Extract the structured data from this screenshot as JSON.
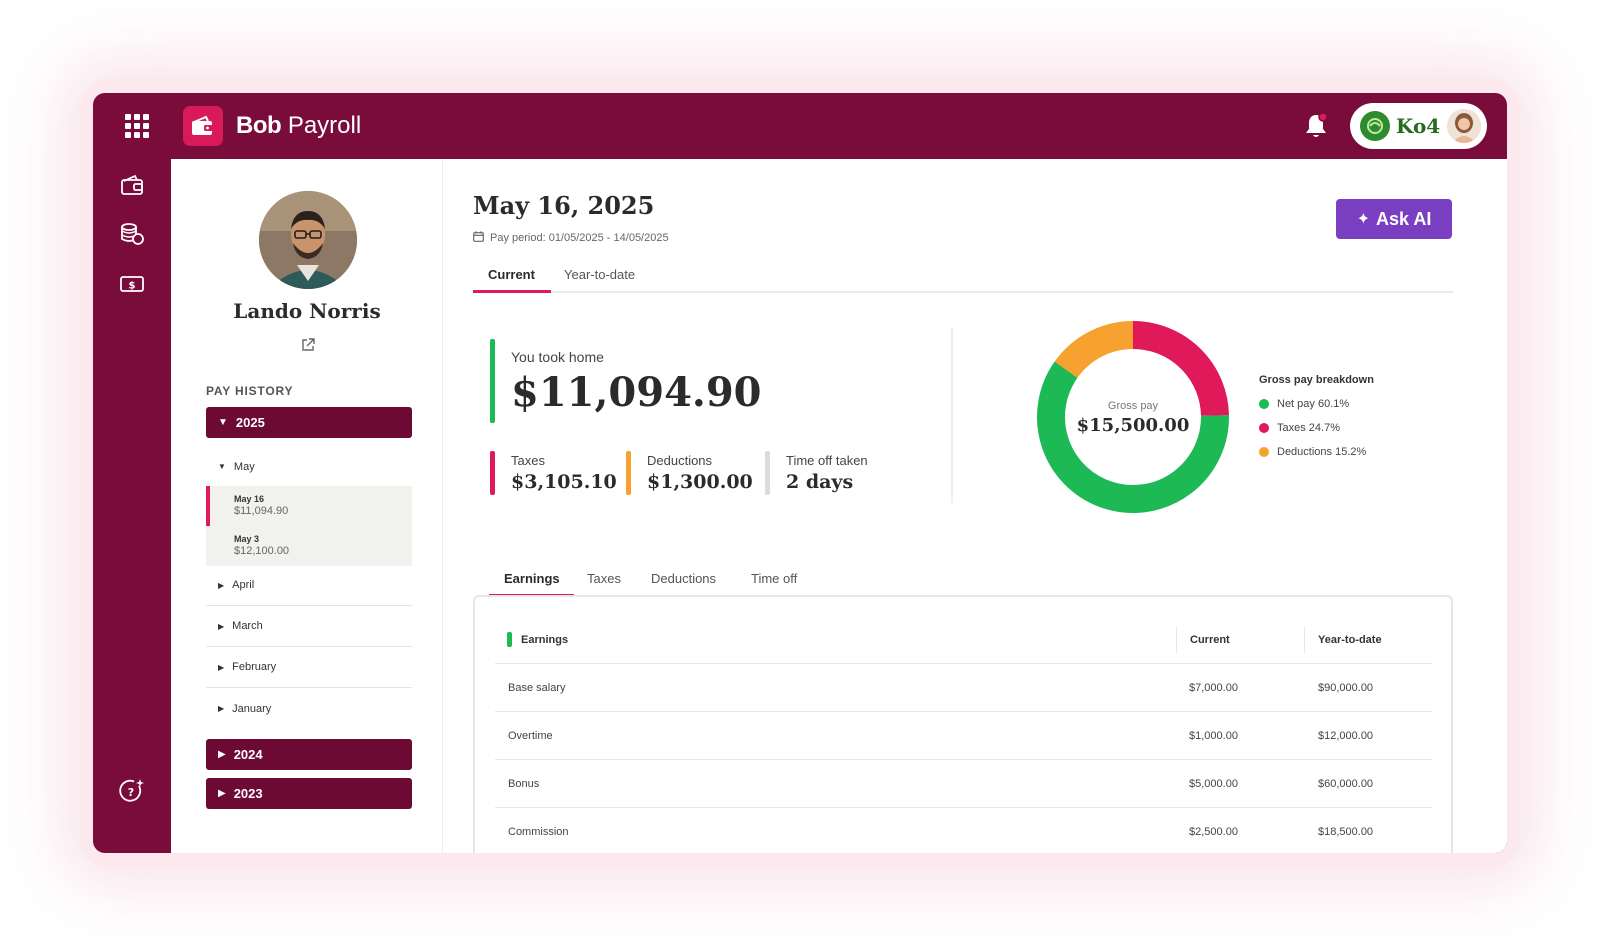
{
  "app": {
    "brand_bold": "Bob",
    "brand_light": "Payroll"
  },
  "account": {
    "company": "Ko4"
  },
  "profile": {
    "name": "Lando Norris"
  },
  "pay_history": {
    "label": "PAY HISTORY",
    "years": [
      {
        "label": "2025",
        "expanded": true
      },
      {
        "label": "2024",
        "expanded": false
      },
      {
        "label": "2023",
        "expanded": false
      }
    ],
    "months": [
      {
        "label": "May",
        "expanded": true
      },
      {
        "label": "April"
      },
      {
        "label": "March"
      },
      {
        "label": "February"
      },
      {
        "label": "January"
      }
    ],
    "payslips": [
      {
        "date": "May 16",
        "amount": "$11,094.90",
        "active": true
      },
      {
        "date": "May 3",
        "amount": "$12,100.00",
        "active": false
      }
    ]
  },
  "payslip": {
    "date_title": "May 16, 2025",
    "period": "Pay period: 01/05/2025 - 14/05/2025",
    "ask_ai": "Ask AI",
    "tabs": [
      "Current",
      "Year-to-date"
    ],
    "took_home_label": "You took home",
    "took_home_value": "$11,094.90",
    "stats": [
      {
        "label": "Taxes",
        "value": "$3,105.10",
        "color": "#e0195a"
      },
      {
        "label": "Deductions",
        "value": "$1,300.00",
        "color": "#f7a130"
      },
      {
        "label": "Time off taken",
        "value": "2 days",
        "color": "#dcdcd6"
      }
    ]
  },
  "breakdown": {
    "center_label": "Gross pay",
    "center_value": "$15,500.00",
    "title": "Gross pay breakdown",
    "items": [
      {
        "label": "Net pay 60.1%",
        "value": 60.1,
        "color": "#1db954"
      },
      {
        "label": "Taxes 24.7%",
        "value": 24.7,
        "color": "#e0195a"
      },
      {
        "label": "Deductions 15.2%",
        "value": 15.2,
        "color": "#f7a130"
      }
    ]
  },
  "details": {
    "tabs": [
      "Earnings",
      "Taxes",
      "Deductions",
      "Time off"
    ],
    "headers": [
      "Earnings",
      "Current",
      "Year-to-date"
    ],
    "rows": [
      {
        "name": "Base salary",
        "current": "$7,000.00",
        "ytd": "$90,000.00"
      },
      {
        "name": "Overtime",
        "current": "$1,000.00",
        "ytd": "$12,000.00"
      },
      {
        "name": "Bonus",
        "current": "$5,000.00",
        "ytd": "$60,000.00"
      },
      {
        "name": "Commission",
        "current": "$2,500.00",
        "ytd": "$18,500.00"
      }
    ]
  },
  "colors": {
    "brand": "#7a0c3b",
    "accent": "#e0195a",
    "ai": "#7a3fc1",
    "positive": "#1db954",
    "warning": "#f7a130"
  }
}
